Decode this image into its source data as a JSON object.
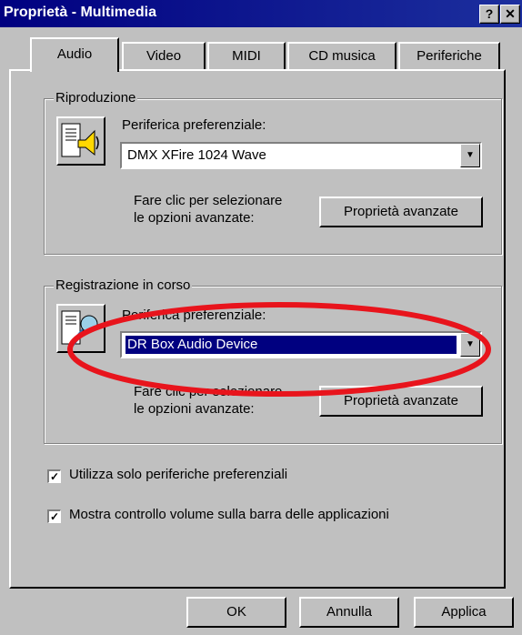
{
  "window": {
    "title": "Proprietà - Multimedia",
    "help_glyph": "?",
    "close_glyph": "✕"
  },
  "tabs": [
    {
      "label": "Audio",
      "active": true
    },
    {
      "label": "Video"
    },
    {
      "label": "MIDI"
    },
    {
      "label": "CD musica"
    },
    {
      "label": "Periferiche"
    }
  ],
  "playback": {
    "group_label": "Riproduzione",
    "icon": "speaker-icon",
    "device_label": "Periferica preferenziale:",
    "device_value": "DMX XFire 1024 Wave",
    "hint_line1": "Fare clic per selezionare",
    "hint_line2": "le opzioni avanzate:",
    "advanced_button": "Proprietà avanzate"
  },
  "recording": {
    "group_label": "Registrazione in corso",
    "icon": "microphone-icon",
    "device_label": "Periferica preferenziale:",
    "device_value": "DR Box Audio Device",
    "hint_line1": "Fare clic per selezionare",
    "hint_line2": "le opzioni avanzate:",
    "advanced_button": "Proprietà avanzate"
  },
  "options": [
    {
      "label": "Utilizza solo periferiche preferenziali",
      "checked": true
    },
    {
      "label": "Mostra controllo volume sulla barra delle applicazioni",
      "checked": true
    }
  ],
  "buttons": {
    "ok": "OK",
    "cancel": "Annulla",
    "apply": "Applica"
  },
  "colors": {
    "titlebar": "#000080",
    "selection": "#000080",
    "annotation": "#e8141c",
    "face": "#c0c0c0"
  }
}
